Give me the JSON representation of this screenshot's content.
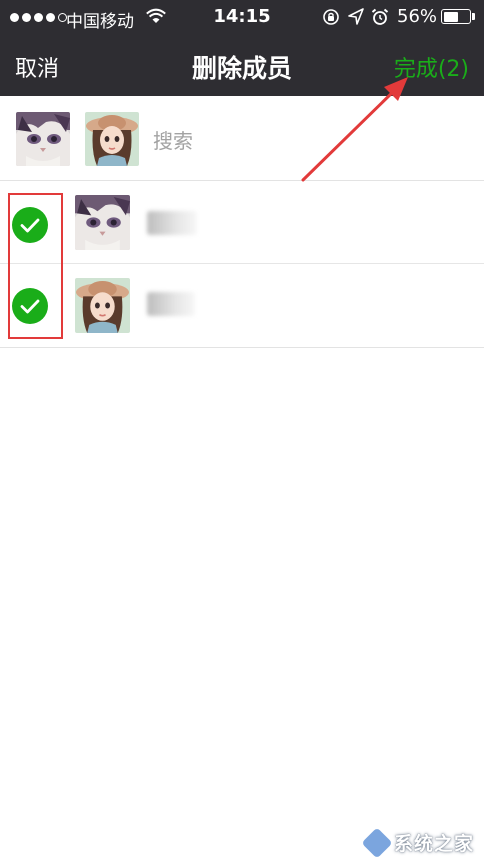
{
  "status_bar": {
    "carrier": "中国移动",
    "time": "14:15",
    "battery_percent": "56%",
    "battery_level": 0.56,
    "signal_bars_filled": 4,
    "signal_bars_total": 5,
    "icons": [
      "wifi-icon",
      "orientation-lock-icon",
      "location-icon",
      "alarm-icon",
      "battery-icon"
    ]
  },
  "nav": {
    "cancel_label": "取消",
    "title": "删除成员",
    "done_label": "完成(2)"
  },
  "search": {
    "placeholder": "搜索",
    "selected_avatars": [
      "cat-avatar",
      "girl-avatar"
    ]
  },
  "members": [
    {
      "avatar": "cat-avatar",
      "checked": true,
      "name_visible": false
    },
    {
      "avatar": "girl-avatar",
      "checked": true,
      "name_visible": false
    }
  ],
  "watermark": {
    "text": "系统之家"
  },
  "colors": {
    "nav_background": "#2e2d32",
    "accent_green": "#1aad19",
    "highlight_red": "#e23a3a",
    "placeholder_gray": "#a3a3a3"
  }
}
